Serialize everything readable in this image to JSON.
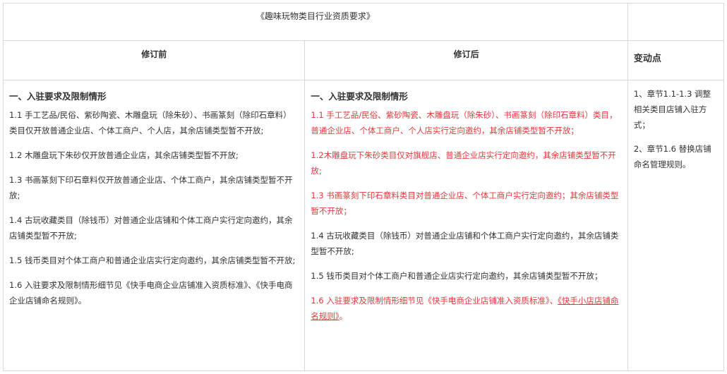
{
  "doc": {
    "title": "《趣味玩物类目行业资质要求》",
    "headers": {
      "before": "修订前",
      "after": "修订后",
      "change": "变动点"
    },
    "before": {
      "section": "一、入驻要求及限制情形",
      "p1": "1.1 手工艺品/民俗、紫砂陶瓷、木雕盘玩（除朱砂）、书画篆刻（除印石章料）类目仅开放普通企业店、个体工商户、个人店，其余店铺类型暂不开放;",
      "p2": "1.2 木雕盘玩下朱砂仅开放普通企业店，其余店铺类型暂不开放;",
      "p3": "1.3 书画篆刻下印石章料仅开放普通企业店、个体工商户，其余店铺类型暂不开放;",
      "p4": "1.4 古玩收藏类目（除钱币）对普通企业店铺和个体工商户实行定向邀约，其余店铺类型暂不开放;",
      "p5": "1.5 钱币类目对个体工商户和普通企业店实行定向邀约，其余店铺类型暂不开放;",
      "p6": "1.6 入驻要求及限制情形细节见《快手电商企业店铺准入资质标准》、《快手电商企业店铺命名规则》。"
    },
    "after": {
      "section": "一、入驻要求及限制情形",
      "p1": "1.1 手工艺品/民俗、紫砂陶瓷、木雕盘玩（除朱砂）、书画篆刻（除印石章料）类目，普通企业店、个体工商户、个人店实行定向邀约，其余店铺类型暂不开放；",
      "p2": "1.2木雕盘玩下朱砂类目仅对旗舰店、普通企业店实行定向邀约，其余店铺类型暂不开放;",
      "p3": "1.3 书画篆刻下印石章料类目对普通企业店、个体工商户实行定向邀约；其余店铺类型暂不开放；",
      "p4": "1.4 古玩收藏类目（除钱币）对普通企业店铺和个体工商户实行定向邀约，其余店铺类型暂不开放;",
      "p5": "1.5 钱币类目对个体工商户和普通企业店实行定向邀约，其余店铺类型暂不开放；",
      "p6_a": "1.6 入驻要求及限制情形细节见《快手电商企业店铺准入资质标准》、",
      "p6_b": "《快手小店店铺命名规则》",
      "p6_c": "。"
    },
    "change": {
      "c1": "1、章节1.1-1.3 调整相关类目店铺入驻方式；",
      "c2": "2、章节1.6 替换店铺命名管理规则。"
    }
  },
  "colors": {
    "text": "#333333",
    "revised": "#e5383b",
    "border": "#d8d8d8"
  }
}
